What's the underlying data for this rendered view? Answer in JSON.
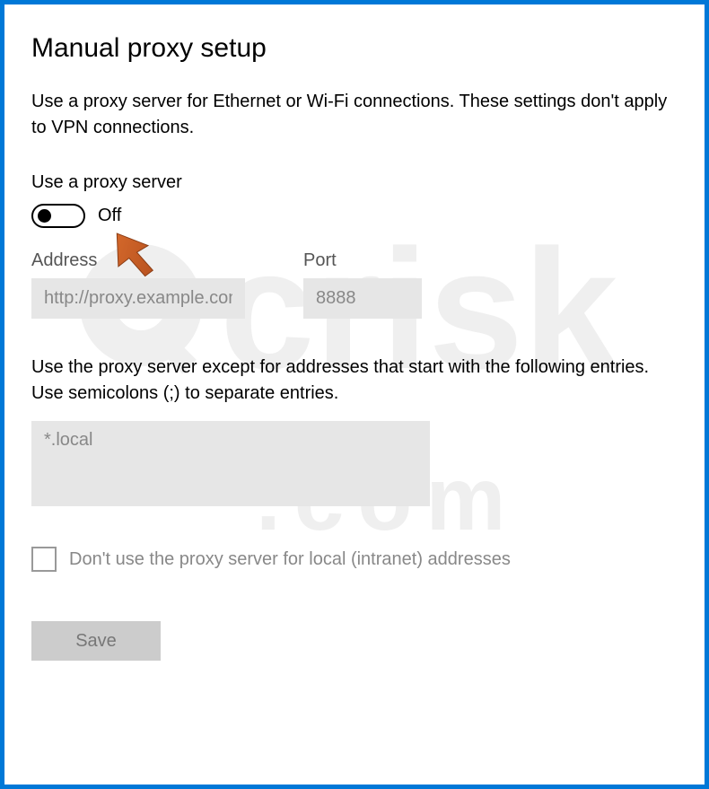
{
  "title": "Manual proxy setup",
  "description": "Use a proxy server for Ethernet or Wi-Fi connections. These settings don't apply to VPN connections.",
  "toggle": {
    "label": "Use a proxy server",
    "state": "Off"
  },
  "address": {
    "label": "Address",
    "value": "http://proxy.example.com"
  },
  "port": {
    "label": "Port",
    "value": "8888"
  },
  "exceptions": {
    "description": "Use the proxy server except for addresses that start with the following entries. Use semicolons (;) to separate entries.",
    "value": "*.local"
  },
  "checkbox": {
    "label": "Don't use the proxy server for local (intranet) addresses"
  },
  "save_label": "Save"
}
